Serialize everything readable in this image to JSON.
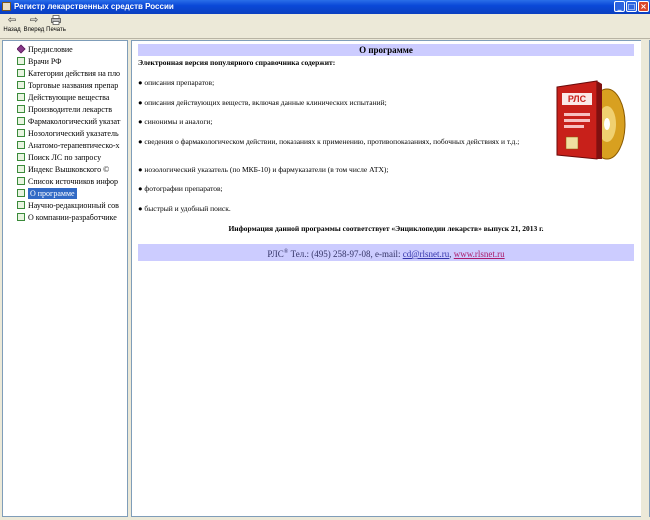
{
  "window": {
    "title": "Регистр лекарственных средств России"
  },
  "toolbar": {
    "back": "Назад",
    "forward": "Вперед",
    "print": "Печать"
  },
  "tree": [
    {
      "label": "Предисловие",
      "icon": "book"
    },
    {
      "label": "Врачи РФ",
      "icon": "page"
    },
    {
      "label": "Категории действия на пло",
      "icon": "page"
    },
    {
      "label": "Торговые названия препар",
      "icon": "page"
    },
    {
      "label": "Действующие вещества",
      "icon": "page"
    },
    {
      "label": "Производители лекарств",
      "icon": "page"
    },
    {
      "label": "Фармакологический указат",
      "icon": "page"
    },
    {
      "label": "Нозологический указатель",
      "icon": "page"
    },
    {
      "label": "Анатомо-терапевтическо-х",
      "icon": "page"
    },
    {
      "label": "Поиск ЛС по запросу",
      "icon": "page"
    },
    {
      "label": "Индекс Вышковского ©",
      "icon": "page"
    },
    {
      "label": "Список источников инфор",
      "icon": "page"
    },
    {
      "label": "О программе",
      "icon": "page",
      "selected": true
    },
    {
      "label": "Научно-редакционный сов",
      "icon": "page"
    },
    {
      "label": "О компании-разработчике",
      "icon": "page"
    }
  ],
  "main": {
    "heading": "О программе",
    "intro": "Электронная версия популярного справочника содержит:",
    "bullets": [
      "● описания препаратов;",
      "● описания действующих веществ, включая данные клинических испытаний;",
      "● синонимы и аналоги;",
      "● сведения о фармакологическом действии, показаниях к применению, противопоказаниях, побочных действиях и т.д.;",
      "● нозологический указатель (по МКБ-10) и фармуказатели (в том числе АТХ);",
      "● фотографии препаратов;",
      "● быстрый и удобный поиск."
    ],
    "footer_note": "Информация данной программы соответствует «Энциклопедии лекарств» выпуск 21, 2013 г.",
    "contact": {
      "brand": "РЛС",
      "reg": "®",
      "phone_text": " Тел.: (495) 258-97-08, e-mail: ",
      "email": "cd@rlsnet.ru",
      "sep": ", ",
      "website": "www.rlsnet.ru"
    },
    "product_box": {
      "logo": "РЛС"
    }
  }
}
